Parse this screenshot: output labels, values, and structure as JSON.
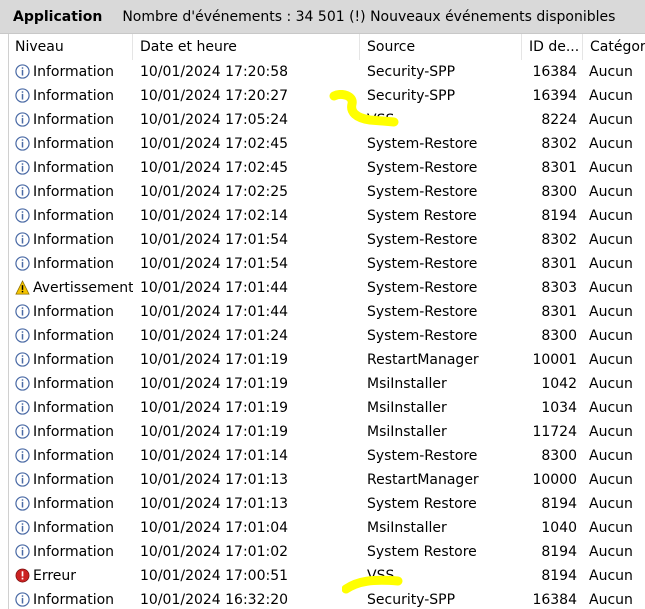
{
  "header": {
    "title": "Application",
    "count_text": "Nombre d'événements : 34 501 (!) Nouveaux événements disponibles"
  },
  "columns": {
    "level": "Niveau",
    "date": "Date et heure",
    "source": "Source",
    "id": "ID de...",
    "category": "Catégori"
  },
  "rows": [
    {
      "level": "Information",
      "icon": "info-icon",
      "date": "10/01/2024 17:20:58",
      "source": "Security-SPP",
      "id": "16384",
      "category": "Aucun"
    },
    {
      "level": "Information",
      "icon": "info-icon",
      "date": "10/01/2024 17:20:27",
      "source": "Security-SPP",
      "id": "16394",
      "category": "Aucun"
    },
    {
      "level": "Information",
      "icon": "info-icon",
      "date": "10/01/2024 17:05:24",
      "source": "VSS",
      "id": "8224",
      "category": "Aucun"
    },
    {
      "level": "Information",
      "icon": "info-icon",
      "date": "10/01/2024 17:02:45",
      "source": "System-Restore",
      "id": "8302",
      "category": "Aucun"
    },
    {
      "level": "Information",
      "icon": "info-icon",
      "date": "10/01/2024 17:02:45",
      "source": "System-Restore",
      "id": "8301",
      "category": "Aucun"
    },
    {
      "level": "Information",
      "icon": "info-icon",
      "date": "10/01/2024 17:02:25",
      "source": "System-Restore",
      "id": "8300",
      "category": "Aucun"
    },
    {
      "level": "Information",
      "icon": "info-icon",
      "date": "10/01/2024 17:02:14",
      "source": "System Restore",
      "id": "8194",
      "category": "Aucun"
    },
    {
      "level": "Information",
      "icon": "info-icon",
      "date": "10/01/2024 17:01:54",
      "source": "System-Restore",
      "id": "8302",
      "category": "Aucun"
    },
    {
      "level": "Information",
      "icon": "info-icon",
      "date": "10/01/2024 17:01:54",
      "source": "System-Restore",
      "id": "8301",
      "category": "Aucun"
    },
    {
      "level": "Avertissement",
      "icon": "warning-icon",
      "date": "10/01/2024 17:01:44",
      "source": "System-Restore",
      "id": "8303",
      "category": "Aucun"
    },
    {
      "level": "Information",
      "icon": "info-icon",
      "date": "10/01/2024 17:01:44",
      "source": "System-Restore",
      "id": "8301",
      "category": "Aucun"
    },
    {
      "level": "Information",
      "icon": "info-icon",
      "date": "10/01/2024 17:01:24",
      "source": "System-Restore",
      "id": "8300",
      "category": "Aucun"
    },
    {
      "level": "Information",
      "icon": "info-icon",
      "date": "10/01/2024 17:01:19",
      "source": "RestartManager",
      "id": "10001",
      "category": "Aucun"
    },
    {
      "level": "Information",
      "icon": "info-icon",
      "date": "10/01/2024 17:01:19",
      "source": "MsiInstaller",
      "id": "1042",
      "category": "Aucun"
    },
    {
      "level": "Information",
      "icon": "info-icon",
      "date": "10/01/2024 17:01:19",
      "source": "MsiInstaller",
      "id": "1034",
      "category": "Aucun"
    },
    {
      "level": "Information",
      "icon": "info-icon",
      "date": "10/01/2024 17:01:19",
      "source": "MsiInstaller",
      "id": "11724",
      "category": "Aucun"
    },
    {
      "level": "Information",
      "icon": "info-icon",
      "date": "10/01/2024 17:01:14",
      "source": "System-Restore",
      "id": "8300",
      "category": "Aucun"
    },
    {
      "level": "Information",
      "icon": "info-icon",
      "date": "10/01/2024 17:01:13",
      "source": "RestartManager",
      "id": "10000",
      "category": "Aucun"
    },
    {
      "level": "Information",
      "icon": "info-icon",
      "date": "10/01/2024 17:01:13",
      "source": "System Restore",
      "id": "8194",
      "category": "Aucun"
    },
    {
      "level": "Information",
      "icon": "info-icon",
      "date": "10/01/2024 17:01:04",
      "source": "MsiInstaller",
      "id": "1040",
      "category": "Aucun"
    },
    {
      "level": "Information",
      "icon": "info-icon",
      "date": "10/01/2024 17:01:02",
      "source": "System Restore",
      "id": "8194",
      "category": "Aucun"
    },
    {
      "level": "Erreur",
      "icon": "error-icon",
      "date": "10/01/2024 17:00:51",
      "source": "VSS",
      "id": "8194",
      "category": "Aucun"
    },
    {
      "level": "Information",
      "icon": "info-icon",
      "date": "10/01/2024 16:32:20",
      "source": "Security-SPP",
      "id": "16384",
      "category": "Aucun"
    }
  ],
  "colors": {
    "header_bg": "#d9d9d9",
    "highlight": "#ffff00",
    "info_icon": "#4a6aa5",
    "warning_icon": "#f5c400",
    "error_icon": "#cc2222"
  }
}
